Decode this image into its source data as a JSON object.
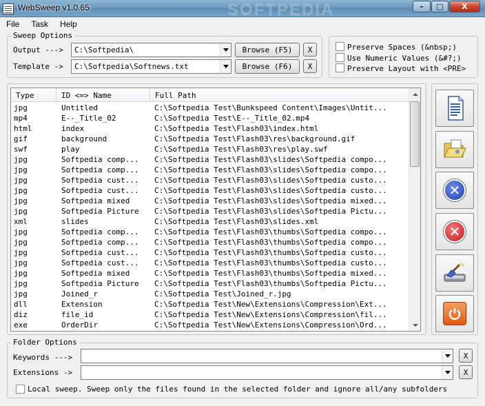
{
  "window": {
    "title": "WebSweep v1.0.65",
    "watermark": "SOFTPEDIA",
    "min": "–",
    "max": "□",
    "close": "X"
  },
  "menu": [
    "File",
    "Task",
    "Help"
  ],
  "sweep_options": {
    "legend": "Sweep Options",
    "output_label": "Output --->",
    "output_value": "C:\\Softpedia\\",
    "template_label": "Template ->",
    "template_value": "C:\\Softpedia\\Softnews.txt",
    "browse_output": "Browse (F5)",
    "browse_template": "Browse (F6)",
    "clear": "X"
  },
  "checkboxes": {
    "preserve_spaces": "Preserve Spaces (&nbsp;)",
    "numeric_values": "Use Numeric Values (&#?;)",
    "preserve_layout": "Preserve Layout with <PRE>"
  },
  "list": {
    "columns": [
      "Type",
      "ID <=> Name",
      "Full Path"
    ],
    "rows": [
      [
        "jpg",
        "Untitled",
        "C:\\Softpedia Test\\Bunkspeed Content\\Images\\Untit..."
      ],
      [
        "mp4",
        "E--_Title_02",
        "C:\\Softpedia Test\\E--_Title_02.mp4"
      ],
      [
        "html",
        "index",
        "C:\\Softpedia Test\\Flash03\\index.html"
      ],
      [
        "gif",
        "background",
        "C:\\Softpedia Test\\Flash03\\res\\background.gif"
      ],
      [
        "swf",
        "play",
        "C:\\Softpedia Test\\Flash03\\res\\play.swf"
      ],
      [
        "jpg",
        "Softpedia comp...",
        "C:\\Softpedia Test\\Flash03\\slides\\Softpedia compo..."
      ],
      [
        "jpg",
        "Softpedia comp...",
        "C:\\Softpedia Test\\Flash03\\slides\\Softpedia compo..."
      ],
      [
        "jpg",
        "Softpedia cust...",
        "C:\\Softpedia Test\\Flash03\\slides\\Softpedia custo..."
      ],
      [
        "jpg",
        "Softpedia cust...",
        "C:\\Softpedia Test\\Flash03\\slides\\Softpedia custo..."
      ],
      [
        "jpg",
        "Softpedia mixed",
        "C:\\Softpedia Test\\Flash03\\slides\\Softpedia mixed..."
      ],
      [
        "jpg",
        "Softpedia Picture",
        "C:\\Softpedia Test\\Flash03\\slides\\Softpedia Pictu..."
      ],
      [
        "xml",
        "slides",
        "C:\\Softpedia Test\\Flash03\\slides.xml"
      ],
      [
        "jpg",
        "Softpedia comp...",
        "C:\\Softpedia Test\\Flash03\\thumbs\\Softpedia compo..."
      ],
      [
        "jpg",
        "Softpedia comp...",
        "C:\\Softpedia Test\\Flash03\\thumbs\\Softpedia compo..."
      ],
      [
        "jpg",
        "Softpedia cust...",
        "C:\\Softpedia Test\\Flash03\\thumbs\\Softpedia custo..."
      ],
      [
        "jpg",
        "Softpedia cust...",
        "C:\\Softpedia Test\\Flash03\\thumbs\\Softpedia custo..."
      ],
      [
        "jpg",
        "Softpedia mixed",
        "C:\\Softpedia Test\\Flash03\\thumbs\\Softpedia mixed..."
      ],
      [
        "jpg",
        "Softpedia Picture",
        "C:\\Softpedia Test\\Flash03\\thumbs\\Softpedia Pictu..."
      ],
      [
        "jpg",
        "Joined_r",
        "C:\\Softpedia Test\\Joined_r.jpg"
      ],
      [
        "dll",
        "Extension",
        "C:\\Softpedia Test\\New\\Extensions\\Compression\\Ext..."
      ],
      [
        "diz",
        "file_id",
        "C:\\Softpedia Test\\New\\Extensions\\Compression\\fil..."
      ],
      [
        "exe",
        "OrderDir",
        "C:\\Softpedia Test\\New\\Extensions\\Compression\\Ord..."
      ]
    ]
  },
  "side_buttons": [
    "new-document",
    "open-folder",
    "clear-blue",
    "remove-red",
    "sweep-brush",
    "power"
  ],
  "folder_options": {
    "legend": "Folder Options",
    "keywords_label": "Keywords --->",
    "extensions_label": "Extensions ->",
    "keywords_value": "",
    "extensions_value": "",
    "clear": "X",
    "local_sweep": "Local sweep. Sweep only the files found in the selected folder and ignore all/any subfolders"
  }
}
